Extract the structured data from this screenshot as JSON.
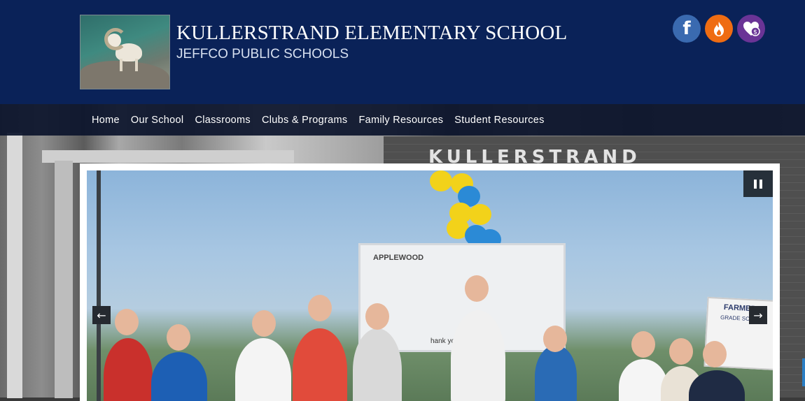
{
  "header": {
    "title": "KULLERSTRAND ELEMENTARY SCHOOL",
    "subtitle": "JEFFCO PUBLIC SCHOOLS",
    "logo_icon": "ram-logo",
    "background_color": "#0a2258"
  },
  "social": {
    "facebook_icon": "facebook-icon",
    "facebook_glyph": "f",
    "flame_icon": "flame-icon",
    "donate_icon": "donate-heart-icon",
    "colors": {
      "facebook": "#3a6ab0",
      "flame": "#ef6c12",
      "donate": "#6a3496"
    }
  },
  "nav": {
    "items": [
      {
        "label": "Home"
      },
      {
        "label": "Our School"
      },
      {
        "label": "Classrooms"
      },
      {
        "label": "Clubs & Programs"
      },
      {
        "label": "Family Resources"
      },
      {
        "label": "Student Resources"
      }
    ]
  },
  "background": {
    "building_sign": "KULLERSTRAND"
  },
  "slideshow": {
    "pause_icon": "pause-icon",
    "prev_icon": "arrow-left-icon",
    "next_icon": "arrow-right-icon",
    "prev_glyph": "←",
    "next_glyph": "→",
    "banner_top_text": "APPLEWOOD",
    "banner_bottom_text": "hank you",
    "sign_title": "FARMER",
    "sign_subtitle": "GRADE SCHOOL"
  }
}
